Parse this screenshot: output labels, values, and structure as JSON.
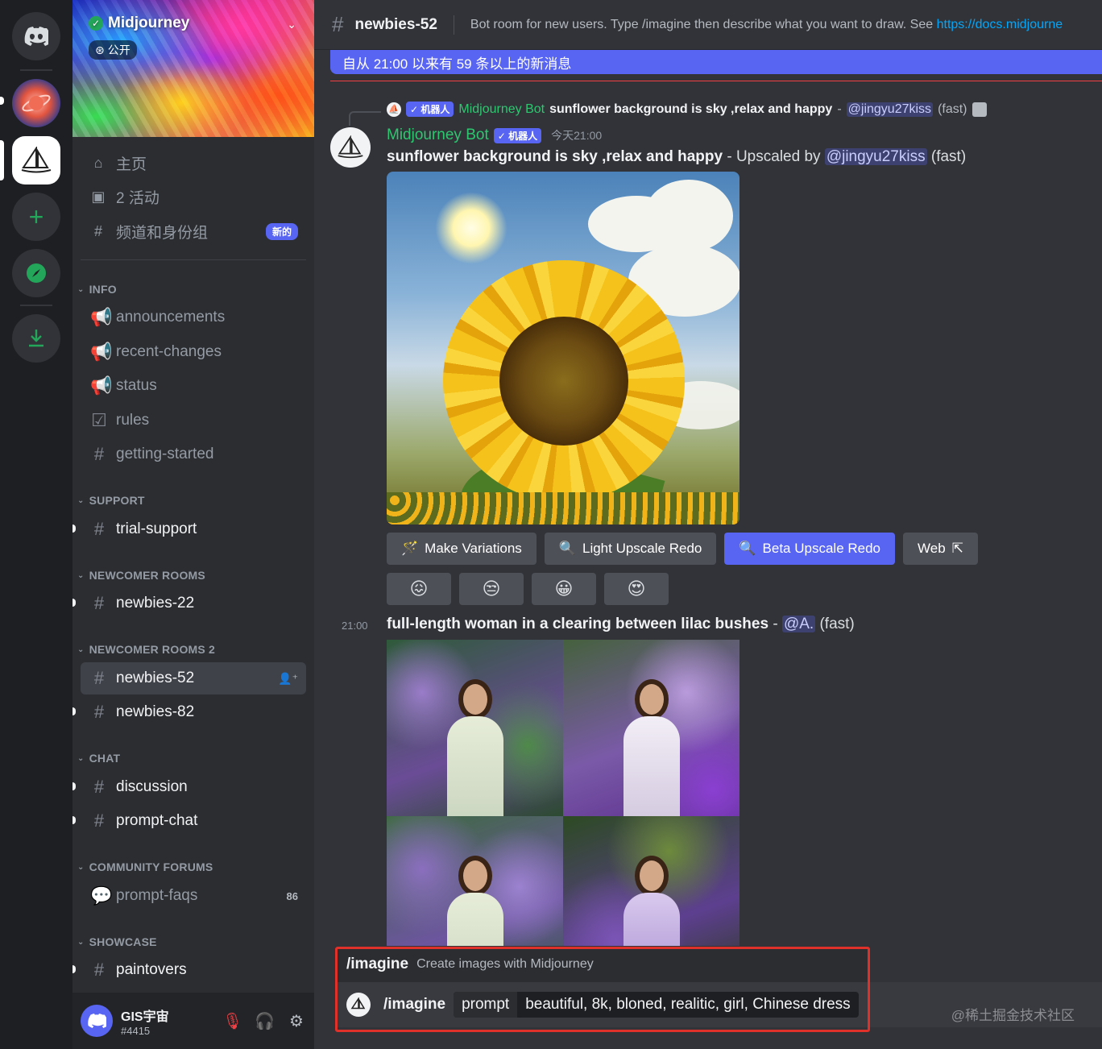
{
  "server": {
    "name": "Midjourney",
    "visibility": "公开"
  },
  "nav": [
    {
      "icon": "home-icon",
      "label": "主页"
    },
    {
      "icon": "calendar-icon",
      "label": "2 活动"
    },
    {
      "icon": "channels-roles-icon",
      "label": "频道和身份组",
      "badge": "新的"
    }
  ],
  "categories": {
    "info": "INFO",
    "support": "SUPPORT",
    "newcomer": "NEWCOMER ROOMS",
    "newcomer2": "NEWCOMER ROOMS 2",
    "chat": "CHAT",
    "forums": "COMMUNITY FORUMS",
    "showcase": "SHOWCASE"
  },
  "channels": {
    "announcements": "announcements",
    "recent_changes": "recent-changes",
    "status": "status",
    "rules": "rules",
    "getting_started": "getting-started",
    "trial_support": "trial-support",
    "newbies_22": "newbies-22",
    "newbies_52": "newbies-52",
    "newbies_82": "newbies-82",
    "discussion": "discussion",
    "prompt_chat": "prompt-chat",
    "prompt_faqs": "prompt-faqs",
    "prompt_faqs_count": "86",
    "paintovers": "paintovers"
  },
  "user": {
    "name": "GIS宇宙",
    "tag": "#4415"
  },
  "header": {
    "channel": "newbies-52",
    "topic": "Bot room for new users. Type /imagine then describe what you want to draw. See ",
    "topic_link": "https://docs.midjourne"
  },
  "new_messages_bar": "自从 21:00 以来有 59 条以上的新消息",
  "reply": {
    "badge": "✓ 机器人",
    "author": "Midjourney Bot",
    "prompt": "sunflower background is sky ,relax and happy",
    "sep": " - ",
    "mention": "@jingyu27kiss",
    "speed": " (fast)"
  },
  "message1": {
    "author": "Midjourney Bot",
    "badge": "✓ 机器人",
    "timestamp": "今天21:00",
    "prompt": "sunflower background is sky ,relax and happy",
    "upscaled_by": " - Upscaled by ",
    "mention": "@jingyu27kiss",
    "speed": " (fast)"
  },
  "buttons": [
    {
      "icon": "magic-wand-icon",
      "label": "Make Variations"
    },
    {
      "icon": "magnifier-icon",
      "label": "Light Upscale Redo"
    },
    {
      "icon": "magnifier-icon",
      "label": "Beta Upscale Redo"
    },
    {
      "icon": "external-link-icon",
      "label": "Web"
    }
  ],
  "reactions": [
    "😖",
    "😒",
    "😀",
    "😍"
  ],
  "message2": {
    "timestamp": "21:00",
    "prompt": "full-length woman in a clearing between lilac bushes",
    "sep": " - ",
    "mention": "@A.",
    "speed": " (fast)"
  },
  "command_popup": {
    "command": "/imagine",
    "description": "Create images with Midjourney"
  },
  "input": {
    "command": "/imagine",
    "option_name": "prompt",
    "option_value": "beautiful, 8k, bloned, realitic, girl, Chinese dress"
  },
  "watermark": "@稀土掘金技术社区",
  "colors": {
    "blurple": "#5865f2",
    "green": "#2dc770",
    "highlight_red": "#e0302a",
    "link": "#00a8fc"
  }
}
